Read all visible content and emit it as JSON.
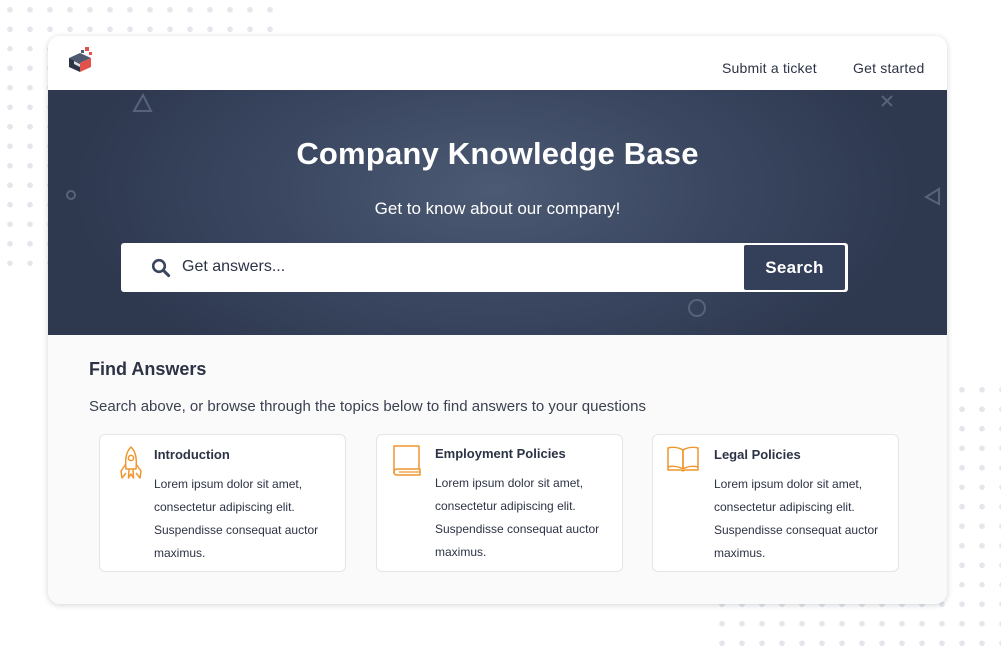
{
  "nav": {
    "submit_ticket": "Submit a ticket",
    "get_started": "Get started"
  },
  "hero": {
    "title": "Company Knowledge Base",
    "subtitle": "Get to know about our company!",
    "search_placeholder": "Get answers...",
    "search_button": "Search"
  },
  "find": {
    "title": "Find Answers",
    "subtitle": "Search above, or browse through the topics below to find answers to your questions"
  },
  "topics": [
    {
      "icon": "rocket-icon",
      "title": "Introduction",
      "body": "Lorem ipsum dolor sit amet, consectetur adipiscing elit. Suspendisse consequat auctor maximus."
    },
    {
      "icon": "book-icon",
      "title": "Employment Policies",
      "body": "Lorem ipsum dolor sit amet, consectetur adipiscing elit. Suspendisse consequat auctor maximus."
    },
    {
      "icon": "open-book-icon",
      "title": "Legal Policies",
      "body": "Lorem ipsum dolor sit amet, consectetur adipiscing elit. Suspendisse consequat auctor maximus."
    }
  ],
  "colors": {
    "hero_bg": "#3a4660",
    "accent_orange": "#f0962f",
    "text_dark": "#2c3345",
    "button_bg": "#34405a"
  }
}
